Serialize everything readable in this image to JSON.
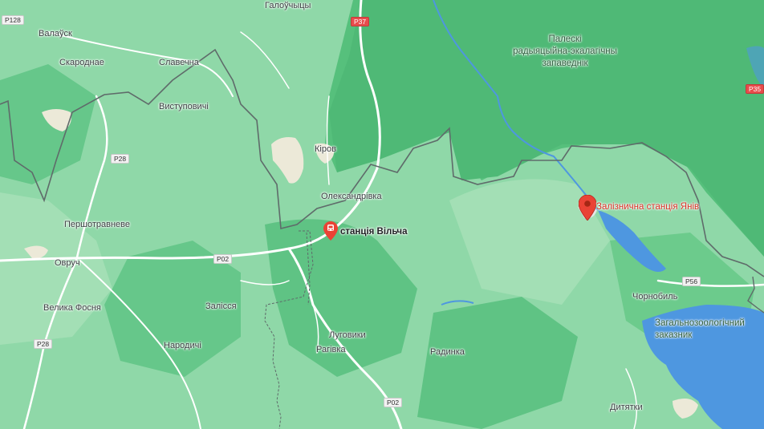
{
  "map": {
    "reserve_label": [
      "Палескі",
      "радыяцыйна-экалагічны",
      "запаведнік"
    ],
    "zoological_reserve_label": [
      "Загальнозоологічний",
      "заказник"
    ],
    "places": [
      {
        "id": "valauck",
        "label": "Валаўск"
      },
      {
        "id": "galouchycy",
        "label": "Галоўчыцы"
      },
      {
        "id": "skarodnae",
        "label": "Скароднае"
      },
      {
        "id": "slavechna",
        "label": "Славечна"
      },
      {
        "id": "vystupovichi",
        "label": "Виступовичі"
      },
      {
        "id": "kirov",
        "label": "Кіров"
      },
      {
        "id": "aleksandrovka",
        "label": "Олександрівка"
      },
      {
        "id": "pershotravneve",
        "label": "Першотравневе"
      },
      {
        "id": "ovruch",
        "label": "Овруч"
      },
      {
        "id": "velyka-fosnia",
        "label": "Велика Фосня"
      },
      {
        "id": "zalissia",
        "label": "Залісся"
      },
      {
        "id": "narodychi",
        "label": "Народичі"
      },
      {
        "id": "luhovyky",
        "label": "Луговики"
      },
      {
        "id": "rahivka",
        "label": "Рагівка"
      },
      {
        "id": "radynka",
        "label": "Радинка"
      },
      {
        "id": "chornobyl",
        "label": "Чорнобиль"
      },
      {
        "id": "dytiatky",
        "label": "Дитятки"
      }
    ],
    "road_shields": [
      {
        "id": "p128",
        "label": "P128",
        "style": "grey"
      },
      {
        "id": "p37",
        "label": "P37",
        "style": "red"
      },
      {
        "id": "p35",
        "label": "P35",
        "style": "red"
      },
      {
        "id": "p28-a",
        "label": "P28",
        "style": "grey"
      },
      {
        "id": "p28-b",
        "label": "P28",
        "style": "grey"
      },
      {
        "id": "p02-a",
        "label": "P02",
        "style": "grey"
      },
      {
        "id": "p02-b",
        "label": "P02",
        "style": "grey"
      },
      {
        "id": "p56",
        "label": "P56",
        "style": "grey"
      }
    ],
    "poi": {
      "vilcha": {
        "label": "станція Вільча",
        "icon": "train-station-pin"
      },
      "yaniv": {
        "label": "Залізнична станція Янів",
        "icon": "red-pin"
      }
    },
    "colors": {
      "land": "#8fd8a8",
      "forest": "#56c07c",
      "clearing": "#b9e6c4",
      "water": "#4e97e0",
      "border": "#5f6b6a",
      "road": "#ffffff",
      "pin_red": "#ea4335"
    }
  }
}
